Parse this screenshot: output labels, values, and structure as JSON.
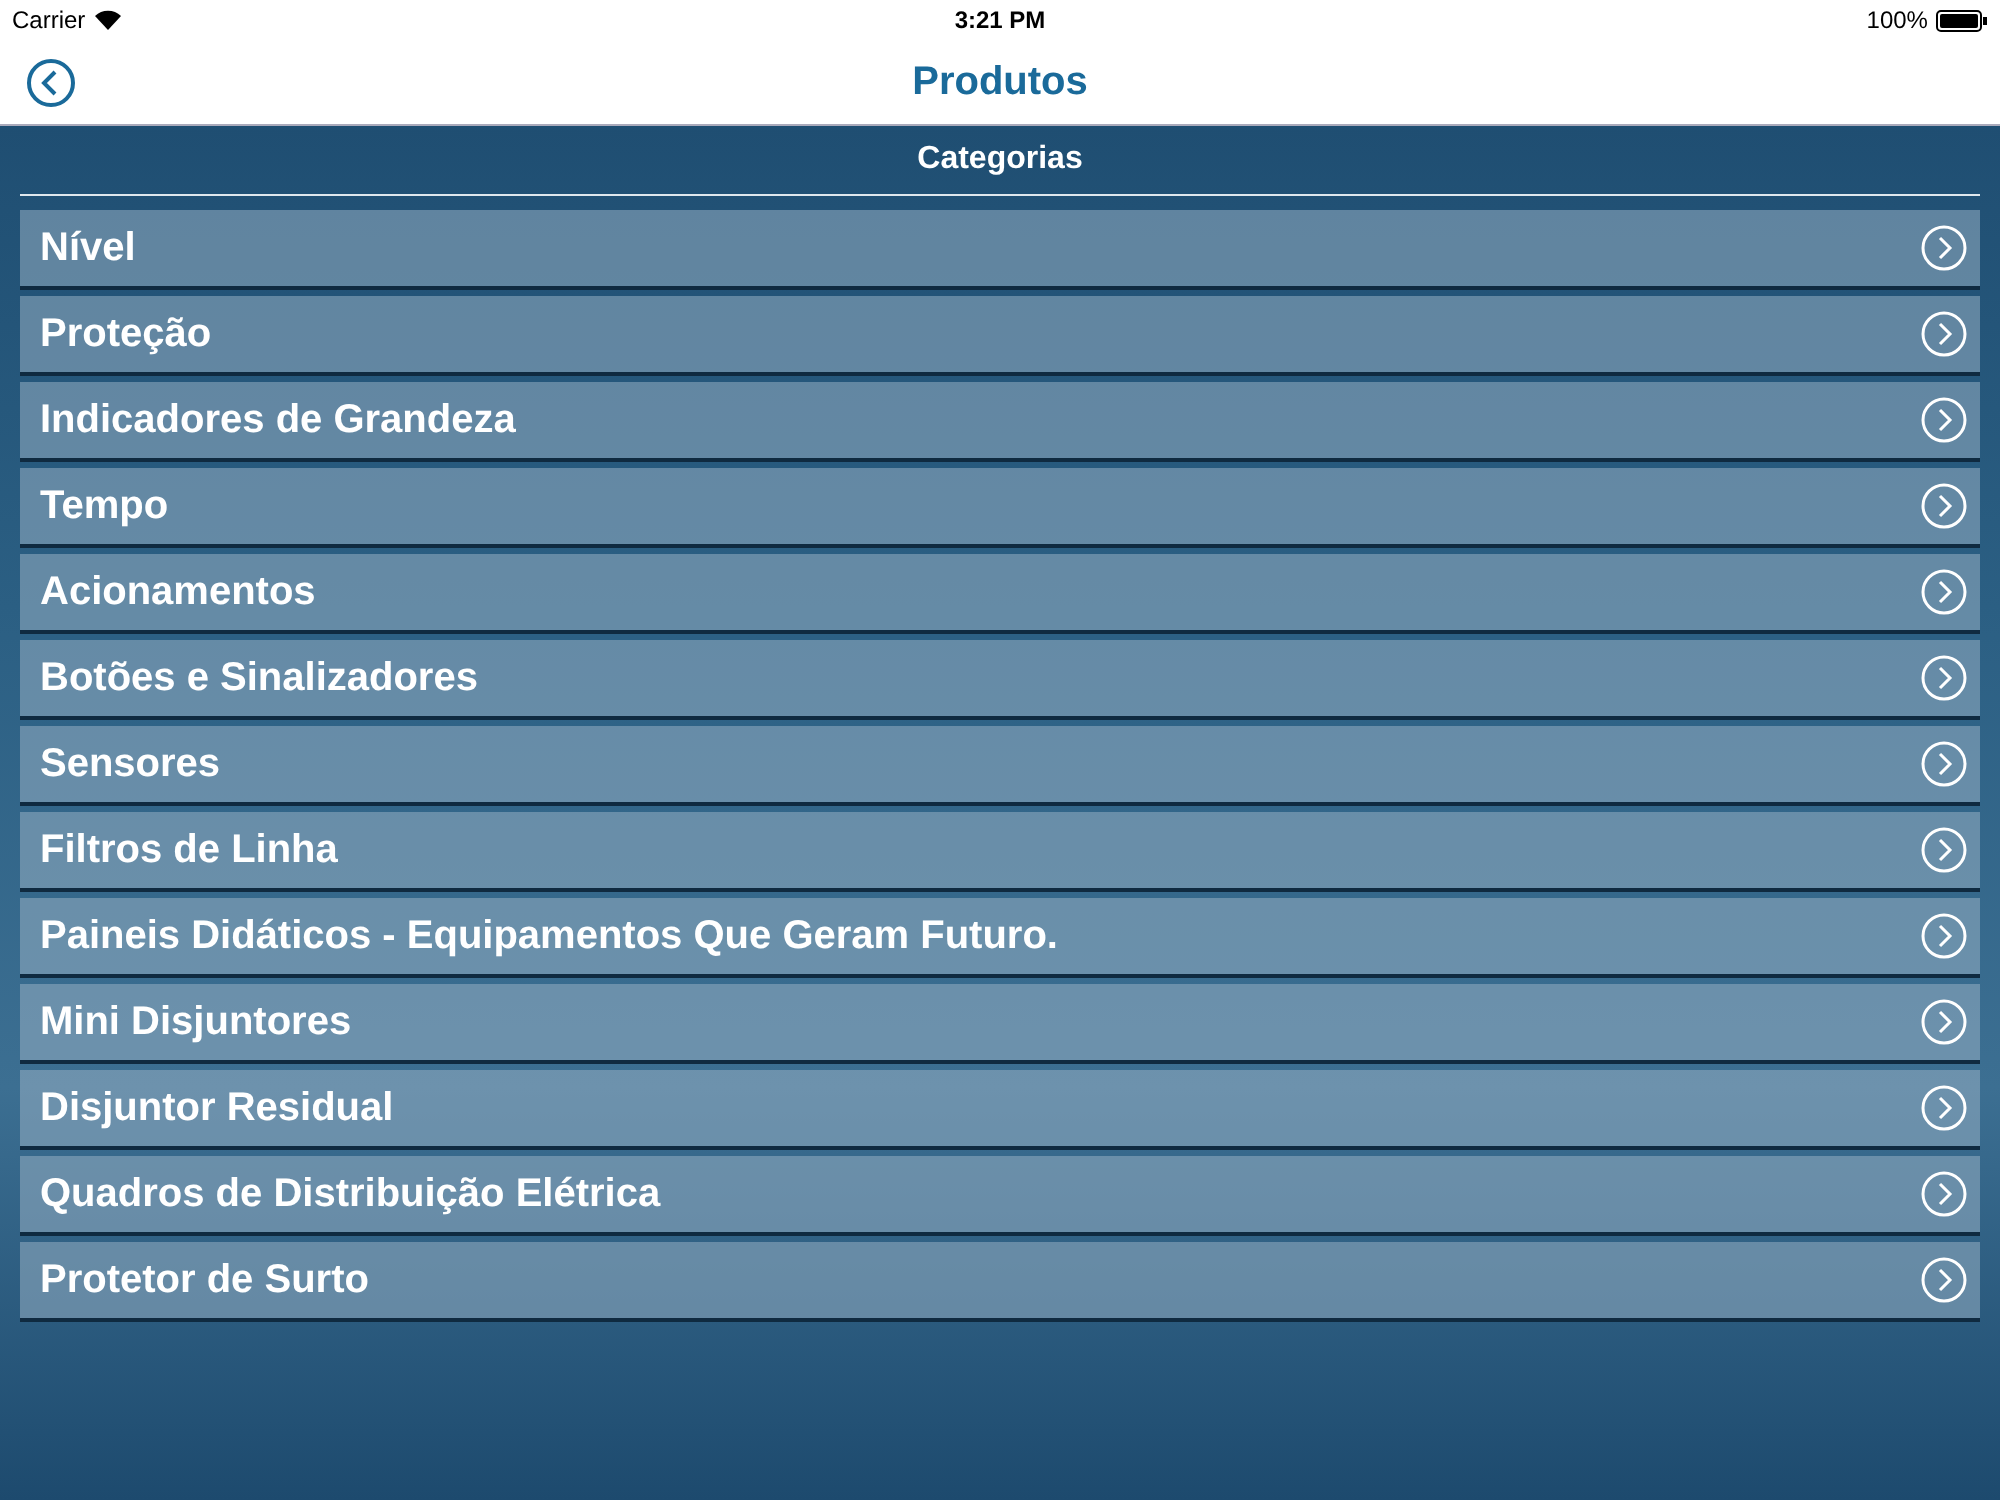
{
  "status_bar": {
    "carrier": "Carrier",
    "time": "3:21 PM",
    "battery": "100%"
  },
  "nav": {
    "title": "Produtos"
  },
  "section": {
    "title": "Categorias"
  },
  "categories": [
    {
      "label": "Nível"
    },
    {
      "label": "Proteção"
    },
    {
      "label": "Indicadores de Grandeza"
    },
    {
      "label": "Tempo"
    },
    {
      "label": "Acionamentos"
    },
    {
      "label": "Botões e Sinalizadores"
    },
    {
      "label": "Sensores"
    },
    {
      "label": "Filtros de Linha"
    },
    {
      "label": "Paineis Didáticos - Equipamentos Que Geram Futuro."
    },
    {
      "label": "Mini Disjuntores"
    },
    {
      "label": "Disjuntor Residual"
    },
    {
      "label": "Quadros de Distribuição Elétrica"
    },
    {
      "label": "Protetor de Surto"
    }
  ]
}
